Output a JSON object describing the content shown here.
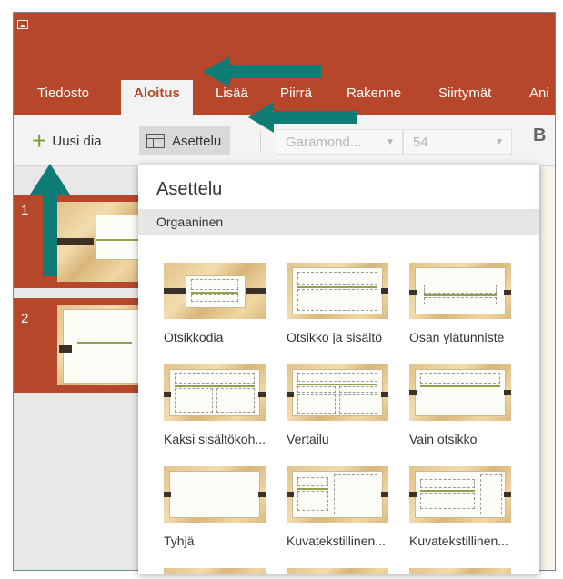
{
  "app": {
    "tabs": [
      "Tiedosto",
      "Aloitus",
      "Lisää",
      "Piirrä",
      "Rakenne",
      "Siirtymät",
      "Ani"
    ],
    "active_tab": "Aloitus"
  },
  "ribbon": {
    "new_slide_label": "Uusi dia",
    "layout_label": "Asettelu",
    "font_name": "Garamond...",
    "font_size": "54",
    "bold_label": "B"
  },
  "thumbnails": {
    "slide_numbers": [
      "1",
      "2"
    ]
  },
  "layout_menu": {
    "title": "Asettelu",
    "section": "Orgaaninen",
    "layouts": [
      "Otsikkodia",
      "Otsikko ja sisältö",
      "Osan ylätunniste",
      "Kaksi sisältökoh...",
      "Vertailu",
      "Vain otsikko",
      "Tyhjä",
      "Kuvatekstillinen...",
      "Kuvatekstillinen..."
    ]
  },
  "colors": {
    "accent": "#b7472a",
    "annotation_arrow": "#0f7c76"
  }
}
